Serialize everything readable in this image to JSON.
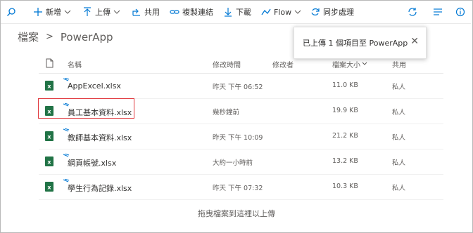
{
  "toolbar": {
    "new_label": "新增",
    "upload_label": "上傳",
    "share_label": "共用",
    "copy_link_label": "複製連結",
    "download_label": "下載",
    "flow_label": "Flow",
    "sync_label": "同步處理"
  },
  "breadcrumb": {
    "root": "檔案",
    "separator": ">",
    "current": "PowerApp"
  },
  "toast": {
    "message": "已上傳 1 個項目至 PowerApp",
    "close": "✕"
  },
  "columns": {
    "name": "名稱",
    "modified": "修改時間",
    "modified_by": "修改者",
    "size": "檔案大小",
    "sharing": "共用"
  },
  "files": [
    {
      "name": "AppExcel.xlsx",
      "modified": "昨天 下午 06:52",
      "size": "11.0 KB",
      "sharing": "私人"
    },
    {
      "name": "員工基本資料.xlsx",
      "modified": "幾秒鐘前",
      "size": "19.9 KB",
      "sharing": "私人"
    },
    {
      "name": "教師基本資料.xlsx",
      "modified": "昨天 下午 10:09",
      "size": "21.2 KB",
      "sharing": "私人"
    },
    {
      "name": "網頁帳號.xlsx",
      "modified": "大約一小時前",
      "size": "13.2 KB",
      "sharing": "私人"
    },
    {
      "name": "學生行為記錄.xlsx",
      "modified": "昨天 下午 07:32",
      "size": "10.3 KB",
      "sharing": "私人"
    }
  ],
  "drop_hint": "拖曳檔案到這裡以上傳",
  "colors": {
    "accent": "#0078d4",
    "excel": "#217346",
    "highlight": "#e0383d"
  }
}
